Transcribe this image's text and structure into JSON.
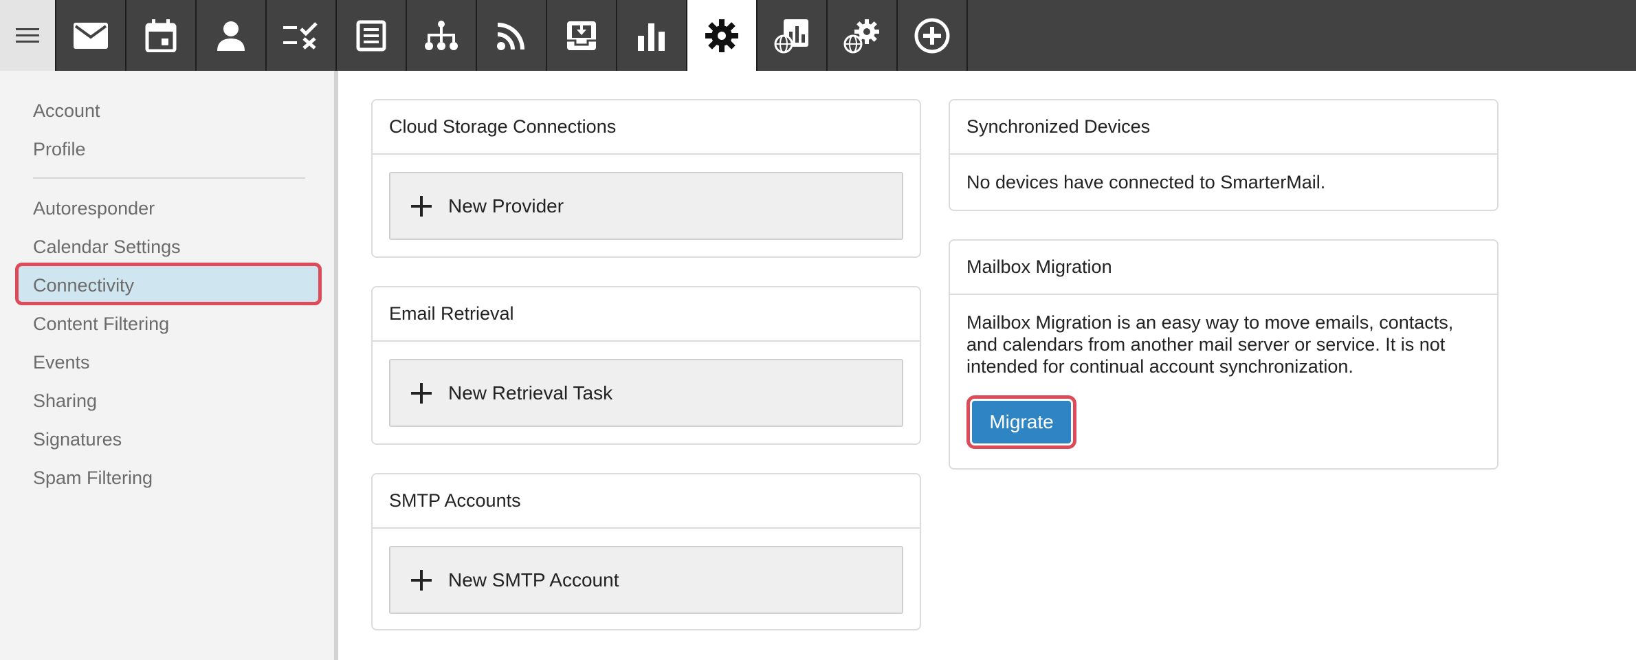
{
  "nav": {
    "items": [
      {
        "icon": "menu-icon"
      },
      {
        "icon": "mail-icon"
      },
      {
        "icon": "calendar-icon"
      },
      {
        "icon": "contacts-icon"
      },
      {
        "icon": "tasks-icon"
      },
      {
        "icon": "notes-icon"
      },
      {
        "icon": "sitemap-icon"
      },
      {
        "icon": "rss-icon"
      },
      {
        "icon": "inbox-download-icon"
      },
      {
        "icon": "reports-icon"
      },
      {
        "icon": "settings-gear-icon",
        "active": true
      },
      {
        "icon": "domain-reports-icon"
      },
      {
        "icon": "domain-settings-icon"
      },
      {
        "icon": "add-circle-icon"
      }
    ]
  },
  "sidebar": {
    "items": [
      {
        "label": "Account"
      },
      {
        "label": "Profile"
      },
      {
        "label": "Autoresponder"
      },
      {
        "label": "Calendar Settings"
      },
      {
        "label": "Connectivity",
        "active": true
      },
      {
        "label": "Content Filtering"
      },
      {
        "label": "Events"
      },
      {
        "label": "Sharing"
      },
      {
        "label": "Signatures"
      },
      {
        "label": "Spam Filtering"
      }
    ]
  },
  "cards": {
    "cloud": {
      "title": "Cloud Storage Connections",
      "action": "New Provider"
    },
    "retrieval": {
      "title": "Email Retrieval",
      "action": "New Retrieval Task"
    },
    "smtp": {
      "title": "SMTP Accounts",
      "action": "New SMTP Account"
    },
    "devices": {
      "title": "Synchronized Devices",
      "text": "No devices have connected to SmarterMail."
    },
    "migration": {
      "title": "Mailbox Migration",
      "text": "Mailbox Migration is an easy way to move emails, contacts, and calendars from another mail server or service. It is not intended for continual account synchronization.",
      "button": "Migrate"
    }
  },
  "colors": {
    "topbar": "#424242",
    "active_highlight": "#cfe6f1",
    "focus_ring": "#dc4b57",
    "primary_button": "#2f84c4"
  }
}
